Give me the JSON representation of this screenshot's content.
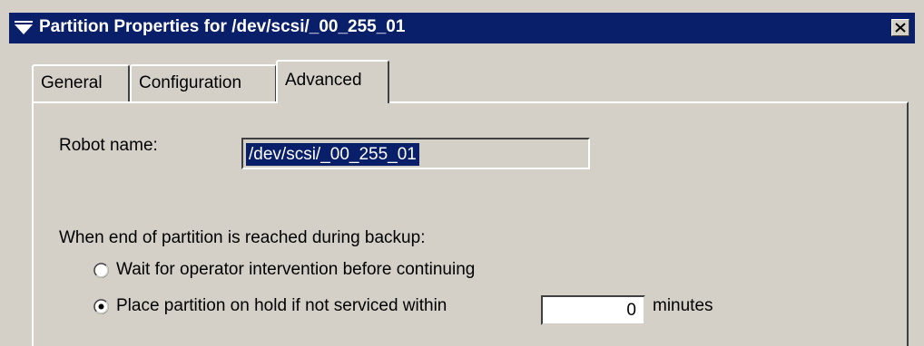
{
  "window": {
    "title": "Partition Properties for /dev/scsi/_00_255_01",
    "close_symbol": "×",
    "title_icon": "collapse-triangle-icon"
  },
  "tabs": [
    {
      "label": "General",
      "active": false
    },
    {
      "label": "Configuration",
      "active": false
    },
    {
      "label": "Advanced",
      "active": true
    }
  ],
  "advanced": {
    "robot_name_label": "Robot name:",
    "robot_name_value": "/dev/scsi/_00_255_01",
    "end_of_partition_label": "When end of partition is reached during backup:",
    "options": [
      {
        "label": "Wait for operator intervention before continuing",
        "selected": false
      },
      {
        "label": "Place partition on hold if not serviced within",
        "selected": true
      }
    ],
    "minutes_value": "0",
    "minutes_label": "minutes"
  },
  "colors": {
    "titlebar": "#0a1f6a",
    "face": "#d4d0c8",
    "selection": "#0a1f6a"
  }
}
